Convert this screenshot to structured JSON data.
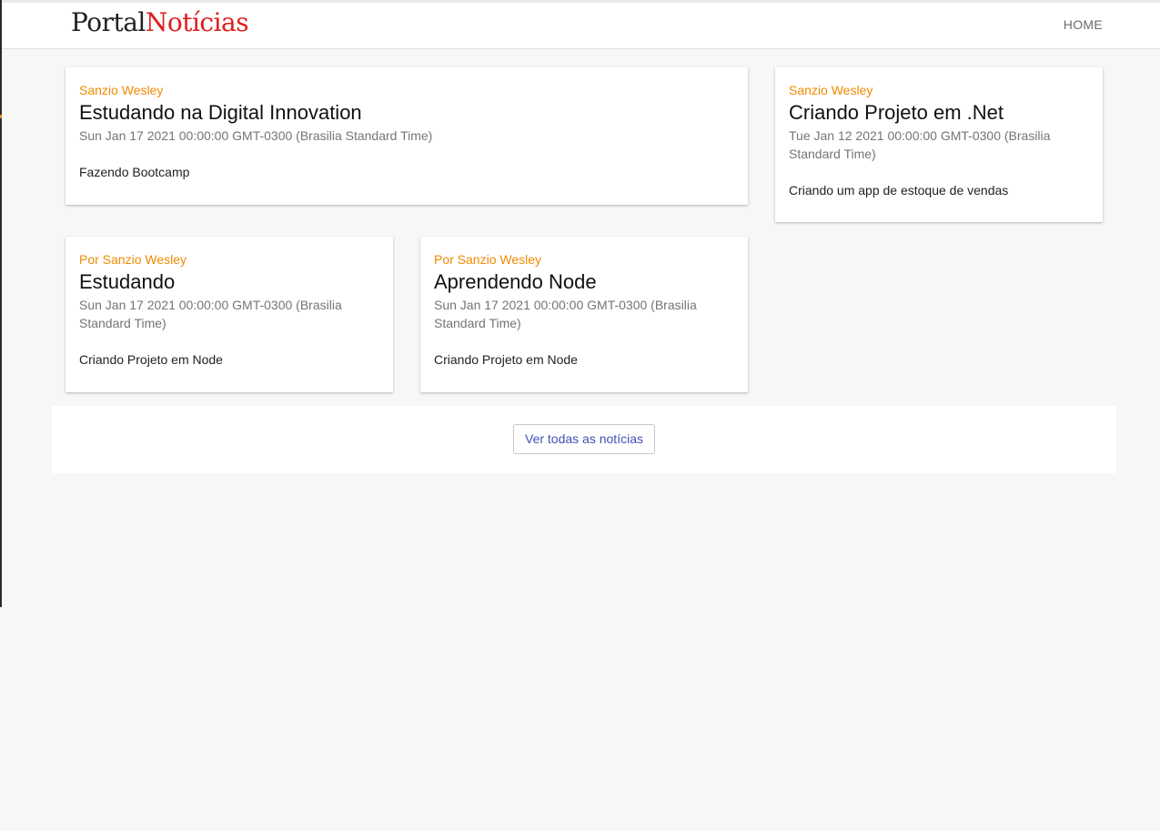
{
  "header": {
    "logo_part1": "Portal",
    "logo_part2": "Notícias",
    "nav_home": "HOME"
  },
  "cards": [
    {
      "author": "Sanzio Wesley",
      "title": "Estudando na Digital Innovation",
      "date": "Sun Jan 17 2021 00:00:00 GMT-0300 (Brasilia Standard Time)",
      "description": "Fazendo Bootcamp"
    },
    {
      "author": "Sanzio Wesley",
      "title": "Criando Projeto em .Net",
      "date": "Tue Jan 12 2021 00:00:00 GMT-0300 (Brasilia Standard Time)",
      "description": "Criando um app de estoque de vendas"
    },
    {
      "author": "Por Sanzio Wesley",
      "title": "Estudando",
      "date": "Sun Jan 17 2021 00:00:00 GMT-0300 (Brasilia Standard Time)",
      "description": "Criando Projeto em Node"
    },
    {
      "author": "Por Sanzio Wesley",
      "title": "Aprendendo Node",
      "date": "Sun Jan 17 2021 00:00:00 GMT-0300 (Brasilia Standard Time)",
      "description": "Criando Projeto em Node"
    }
  ],
  "footer": {
    "see_all_label": "Ver todas as notícias"
  },
  "colors": {
    "author_accent": "#f08a00",
    "logo_red": "#e01d1d",
    "button_text": "#3f51b5",
    "background": "#f7f7f7"
  }
}
